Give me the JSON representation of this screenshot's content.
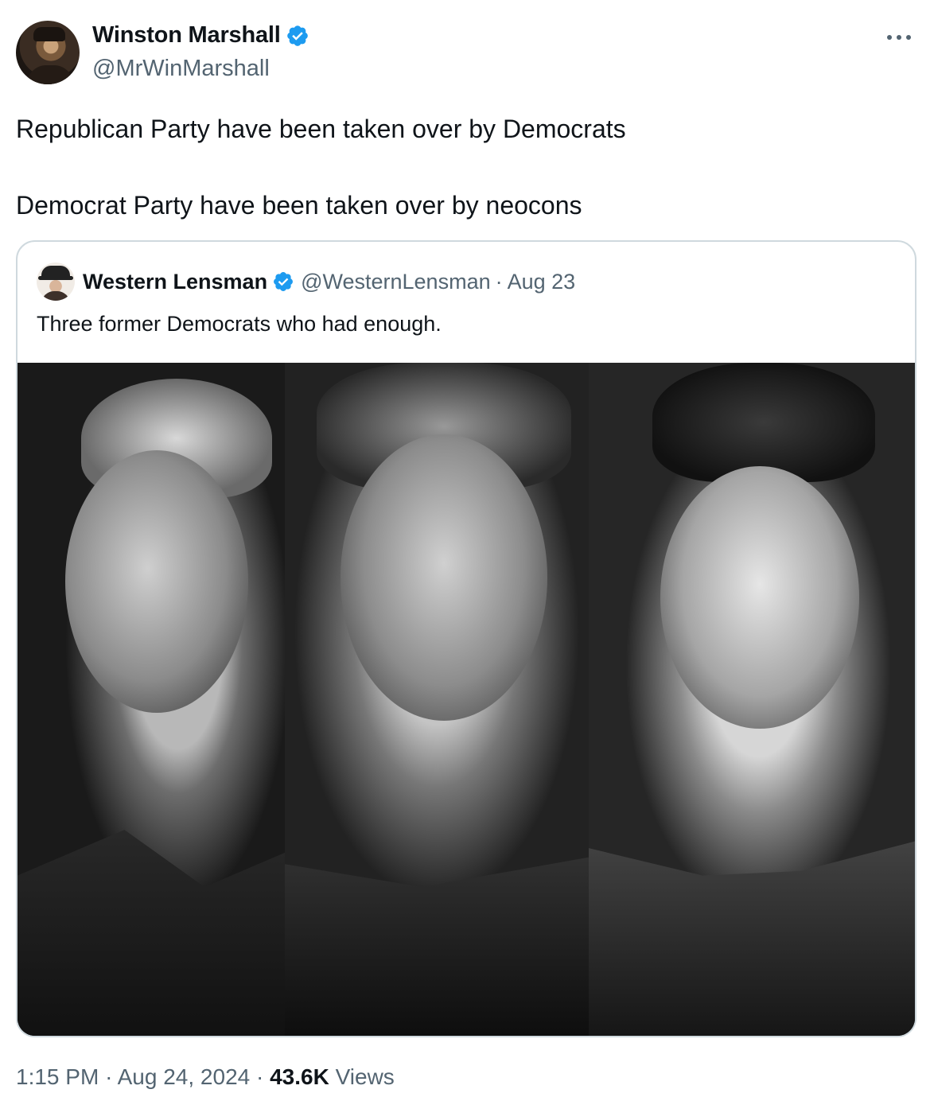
{
  "author": {
    "display_name": "Winston Marshall",
    "handle": "@MrWinMarshall",
    "verified": true,
    "avatar_icon": "profile-photo"
  },
  "tweet": {
    "lines": [
      "Republican Party have been taken over by Democrats",
      "Democrat Party have been taken over by neocons"
    ]
  },
  "quoted": {
    "display_name": "Western Lensman",
    "handle": "@WesternLensman",
    "separator": "·",
    "date": "Aug 23",
    "text": "Three former Democrats who had enough.",
    "media": {
      "panels": [
        "portrait-1",
        "portrait-2",
        "portrait-3"
      ],
      "style": "black-and-white"
    }
  },
  "footer": {
    "time": "1:15 PM",
    "separator": "·",
    "date": "Aug 24, 2024",
    "views_count": "43.6K",
    "views_label": "Views"
  },
  "colors": {
    "verified_blue": "#1d9bf0",
    "text_primary": "#0f1419",
    "text_secondary": "#536471",
    "border": "#cfd9de"
  }
}
